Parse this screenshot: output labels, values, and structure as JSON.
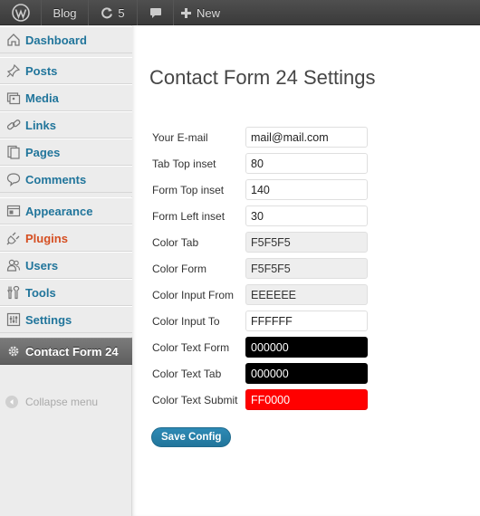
{
  "adminbar": {
    "site_label": "Blog",
    "updates_count": "5",
    "new_label": "New"
  },
  "sidebar": {
    "items": [
      {
        "label": "Dashboard",
        "icon": "dashboard-icon"
      },
      {
        "label": "Posts",
        "icon": "pushpin-icon"
      },
      {
        "label": "Media",
        "icon": "media-icon"
      },
      {
        "label": "Links",
        "icon": "link-icon"
      },
      {
        "label": "Pages",
        "icon": "pages-icon"
      },
      {
        "label": "Comments",
        "icon": "comment-icon"
      },
      {
        "label": "Appearance",
        "icon": "appearance-icon"
      },
      {
        "label": "Plugins",
        "icon": "plug-icon"
      },
      {
        "label": "Users",
        "icon": "users-icon"
      },
      {
        "label": "Tools",
        "icon": "tools-icon"
      },
      {
        "label": "Settings",
        "icon": "settings-icon"
      },
      {
        "label": "Contact Form 24",
        "icon": "gear-icon"
      }
    ],
    "collapse_label": "Collapse menu"
  },
  "main": {
    "title": "Contact Form 24 Settings",
    "fields": [
      {
        "label": "Your E-mail",
        "value": "mail@mail.com"
      },
      {
        "label": "Tab Top inset",
        "value": "80"
      },
      {
        "label": "Form Top inset",
        "value": "140"
      },
      {
        "label": "Form Left inset",
        "value": "30"
      },
      {
        "label": "Color Tab",
        "value": "F5F5F5"
      },
      {
        "label": "Color Form",
        "value": "F5F5F5"
      },
      {
        "label": "Color Input From",
        "value": "EEEEEE"
      },
      {
        "label": "Color Input To",
        "value": "FFFFFF"
      },
      {
        "label": "Color Text Form",
        "value": "000000"
      },
      {
        "label": "Color Text Tab",
        "value": "000000"
      },
      {
        "label": "Color Text Submit",
        "value": "FF0000"
      }
    ],
    "save_label": "Save Config"
  },
  "colors": {
    "link": "#21759b",
    "plugins_active": "#d54e21",
    "admin_bar": "#464646",
    "submit_swatch": "#ff0000",
    "black_swatch": "#000000"
  }
}
